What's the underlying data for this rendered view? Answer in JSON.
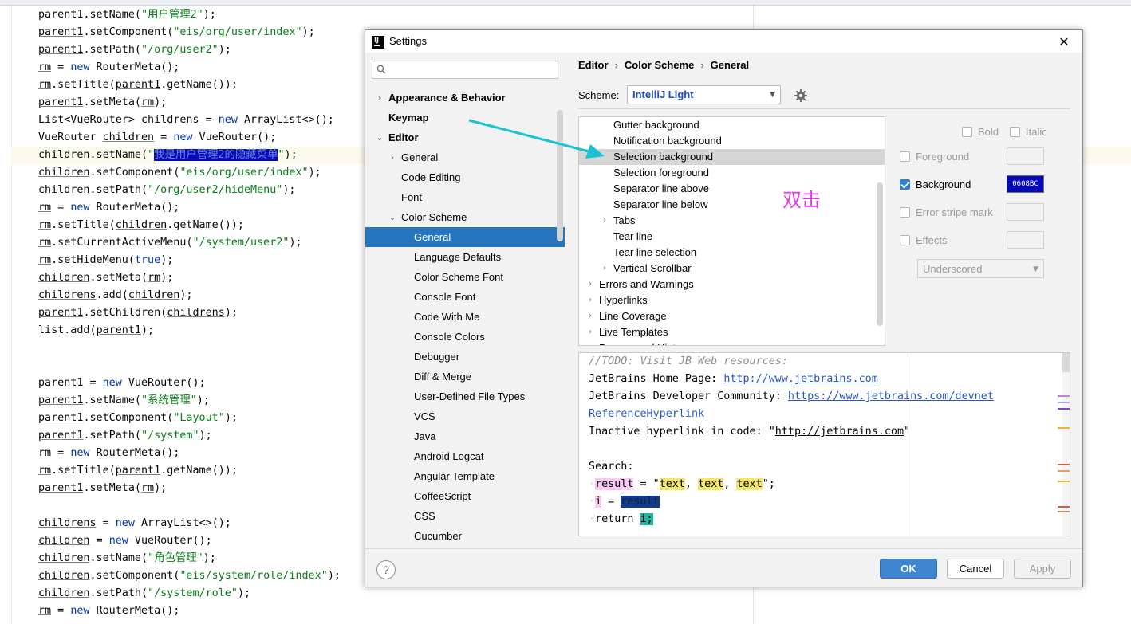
{
  "editor": {
    "lines": [
      {
        "segments": [
          {
            "t": "parent1.setName(",
            "c": ""
          },
          {
            "t": "\"用户管理2\"",
            "c": "str"
          },
          {
            "t": ");",
            "c": ""
          }
        ]
      },
      {
        "segments": [
          {
            "t": "parent1",
            "c": "u"
          },
          {
            "t": ".setComponent(",
            "c": ""
          },
          {
            "t": "\"eis/org/user/index\"",
            "c": "str"
          },
          {
            "t": ");",
            "c": ""
          }
        ]
      },
      {
        "segments": [
          {
            "t": "parent1",
            "c": "u"
          },
          {
            "t": ".setPath(",
            "c": ""
          },
          {
            "t": "\"/org/user2\"",
            "c": "str"
          },
          {
            "t": ");",
            "c": ""
          }
        ]
      },
      {
        "segments": [
          {
            "t": "rm",
            "c": "u"
          },
          {
            "t": " = ",
            "c": ""
          },
          {
            "t": "new",
            "c": "kw"
          },
          {
            "t": " RouterMeta();",
            "c": ""
          }
        ]
      },
      {
        "segments": [
          {
            "t": "rm",
            "c": "u"
          },
          {
            "t": ".setTitle(",
            "c": ""
          },
          {
            "t": "parent1",
            "c": "u"
          },
          {
            "t": ".getName());",
            "c": ""
          }
        ]
      },
      {
        "segments": [
          {
            "t": "parent1",
            "c": "u"
          },
          {
            "t": ".setMeta(",
            "c": ""
          },
          {
            "t": "rm",
            "c": "u"
          },
          {
            "t": ");",
            "c": ""
          }
        ]
      },
      {
        "segments": [
          {
            "t": "List<VueRouter> ",
            "c": ""
          },
          {
            "t": "childrens",
            "c": "u"
          },
          {
            "t": " = ",
            "c": ""
          },
          {
            "t": "new",
            "c": "kw"
          },
          {
            "t": " ArrayList<>();",
            "c": ""
          }
        ]
      },
      {
        "segments": [
          {
            "t": "VueRouter ",
            "c": ""
          },
          {
            "t": "children",
            "c": "u"
          },
          {
            "t": " = ",
            "c": ""
          },
          {
            "t": "new",
            "c": "kw"
          },
          {
            "t": " VueRouter();",
            "c": ""
          }
        ]
      },
      {
        "highlight": true,
        "segments": [
          {
            "t": "children",
            "c": "u"
          },
          {
            "t": ".setName(",
            "c": ""
          },
          {
            "t": "\"",
            "c": "str"
          },
          {
            "t": "我是用户管理2的隐藏菜单",
            "c": "selstr"
          },
          {
            "t": "\"",
            "c": "str"
          },
          {
            "t": ");",
            "c": ""
          }
        ]
      },
      {
        "segments": [
          {
            "t": "children",
            "c": "u"
          },
          {
            "t": ".setComponent(",
            "c": ""
          },
          {
            "t": "\"eis/org/user/index\"",
            "c": "str"
          },
          {
            "t": ");",
            "c": ""
          }
        ]
      },
      {
        "segments": [
          {
            "t": "children",
            "c": "u"
          },
          {
            "t": ".setPath(",
            "c": ""
          },
          {
            "t": "\"/org/user2/hideMenu\"",
            "c": "str"
          },
          {
            "t": ");",
            "c": ""
          }
        ]
      },
      {
        "segments": [
          {
            "t": "rm",
            "c": "u"
          },
          {
            "t": " = ",
            "c": ""
          },
          {
            "t": "new",
            "c": "kw"
          },
          {
            "t": " RouterMeta();",
            "c": ""
          }
        ]
      },
      {
        "segments": [
          {
            "t": "rm",
            "c": "u"
          },
          {
            "t": ".setTitle(",
            "c": ""
          },
          {
            "t": "children",
            "c": "u"
          },
          {
            "t": ".getName());",
            "c": ""
          }
        ]
      },
      {
        "segments": [
          {
            "t": "rm",
            "c": "u"
          },
          {
            "t": ".setCurrentActiveMenu(",
            "c": ""
          },
          {
            "t": "\"/system/user2\"",
            "c": "str"
          },
          {
            "t": ");",
            "c": ""
          }
        ]
      },
      {
        "segments": [
          {
            "t": "rm",
            "c": "u"
          },
          {
            "t": ".setHideMenu(",
            "c": ""
          },
          {
            "t": "true",
            "c": "kw"
          },
          {
            "t": ");",
            "c": ""
          }
        ]
      },
      {
        "segments": [
          {
            "t": "children",
            "c": "u"
          },
          {
            "t": ".setMeta(",
            "c": ""
          },
          {
            "t": "rm",
            "c": "u"
          },
          {
            "t": ");",
            "c": ""
          }
        ]
      },
      {
        "segments": [
          {
            "t": "childrens",
            "c": "u"
          },
          {
            "t": ".add(",
            "c": ""
          },
          {
            "t": "children",
            "c": "u"
          },
          {
            "t": ");",
            "c": ""
          }
        ]
      },
      {
        "segments": [
          {
            "t": "parent1",
            "c": "u"
          },
          {
            "t": ".setChildren(",
            "c": ""
          },
          {
            "t": "childrens",
            "c": "u"
          },
          {
            "t": ");",
            "c": ""
          }
        ]
      },
      {
        "segments": [
          {
            "t": "list.add(",
            "c": ""
          },
          {
            "t": "parent1",
            "c": "u"
          },
          {
            "t": ");",
            "c": ""
          }
        ]
      },
      {
        "segments": []
      },
      {
        "segments": []
      },
      {
        "segments": [
          {
            "t": "parent1",
            "c": "u"
          },
          {
            "t": " = ",
            "c": ""
          },
          {
            "t": "new",
            "c": "kw"
          },
          {
            "t": " VueRouter();",
            "c": ""
          }
        ]
      },
      {
        "segments": [
          {
            "t": "parent1",
            "c": "u"
          },
          {
            "t": ".setName(",
            "c": ""
          },
          {
            "t": "\"系统管理\"",
            "c": "str"
          },
          {
            "t": ");",
            "c": ""
          }
        ]
      },
      {
        "segments": [
          {
            "t": "parent1",
            "c": "u"
          },
          {
            "t": ".setComponent(",
            "c": ""
          },
          {
            "t": "\"Layout\"",
            "c": "str"
          },
          {
            "t": ");",
            "c": ""
          }
        ]
      },
      {
        "segments": [
          {
            "t": "parent1",
            "c": "u"
          },
          {
            "t": ".setPath(",
            "c": ""
          },
          {
            "t": "\"/system\"",
            "c": "str"
          },
          {
            "t": ");",
            "c": ""
          }
        ]
      },
      {
        "segments": [
          {
            "t": "rm",
            "c": "u"
          },
          {
            "t": " = ",
            "c": ""
          },
          {
            "t": "new",
            "c": "kw"
          },
          {
            "t": " RouterMeta();",
            "c": ""
          }
        ]
      },
      {
        "segments": [
          {
            "t": "rm",
            "c": "u"
          },
          {
            "t": ".setTitle(",
            "c": ""
          },
          {
            "t": "parent1",
            "c": "u"
          },
          {
            "t": ".getName());",
            "c": ""
          }
        ]
      },
      {
        "segments": [
          {
            "t": "parent1",
            "c": "u"
          },
          {
            "t": ".setMeta(",
            "c": ""
          },
          {
            "t": "rm",
            "c": "u"
          },
          {
            "t": ");",
            "c": ""
          }
        ]
      },
      {
        "segments": []
      },
      {
        "segments": [
          {
            "t": "childrens",
            "c": "u"
          },
          {
            "t": " = ",
            "c": ""
          },
          {
            "t": "new",
            "c": "kw"
          },
          {
            "t": " ArrayList<>();",
            "c": ""
          }
        ]
      },
      {
        "segments": [
          {
            "t": "children",
            "c": "u"
          },
          {
            "t": " = ",
            "c": ""
          },
          {
            "t": "new",
            "c": "kw"
          },
          {
            "t": " VueRouter();",
            "c": ""
          }
        ]
      },
      {
        "segments": [
          {
            "t": "children",
            "c": "u"
          },
          {
            "t": ".setName(",
            "c": ""
          },
          {
            "t": "\"角色管理\"",
            "c": "str"
          },
          {
            "t": ");",
            "c": ""
          }
        ]
      },
      {
        "segments": [
          {
            "t": "children",
            "c": "u"
          },
          {
            "t": ".setComponent(",
            "c": ""
          },
          {
            "t": "\"eis/system/role/index\"",
            "c": "str"
          },
          {
            "t": ");",
            "c": ""
          }
        ]
      },
      {
        "segments": [
          {
            "t": "children",
            "c": "u"
          },
          {
            "t": ".setPath(",
            "c": ""
          },
          {
            "t": "\"/system/role\"",
            "c": "str"
          },
          {
            "t": ");",
            "c": ""
          }
        ]
      },
      {
        "segments": [
          {
            "t": "rm",
            "c": "u"
          },
          {
            "t": " = ",
            "c": ""
          },
          {
            "t": "new",
            "c": "kw"
          },
          {
            "t": " RouterMeta();",
            "c": ""
          }
        ]
      }
    ]
  },
  "dialog": {
    "title": "Settings",
    "close_icon": "close-icon",
    "search": {
      "placeholder": "",
      "value": ""
    },
    "sidebar": {
      "items": [
        {
          "label": "Appearance & Behavior",
          "level": 0,
          "arrow": "right",
          "bold": true
        },
        {
          "label": "Keymap",
          "level": 0,
          "arrow": "none",
          "bold": true
        },
        {
          "label": "Editor",
          "level": 0,
          "arrow": "down",
          "bold": true
        },
        {
          "label": "General",
          "level": 1,
          "arrow": "right"
        },
        {
          "label": "Code Editing",
          "level": 1,
          "arrow": "none"
        },
        {
          "label": "Font",
          "level": 1,
          "arrow": "none"
        },
        {
          "label": "Color Scheme",
          "level": 1,
          "arrow": "down"
        },
        {
          "label": "General",
          "level": 2,
          "arrow": "none",
          "selected": true
        },
        {
          "label": "Language Defaults",
          "level": 2,
          "arrow": "none"
        },
        {
          "label": "Color Scheme Font",
          "level": 2,
          "arrow": "none"
        },
        {
          "label": "Console Font",
          "level": 2,
          "arrow": "none"
        },
        {
          "label": "Code With Me",
          "level": 2,
          "arrow": "none"
        },
        {
          "label": "Console Colors",
          "level": 2,
          "arrow": "none"
        },
        {
          "label": "Debugger",
          "level": 2,
          "arrow": "none"
        },
        {
          "label": "Diff & Merge",
          "level": 2,
          "arrow": "none"
        },
        {
          "label": "User-Defined File Types",
          "level": 2,
          "arrow": "none"
        },
        {
          "label": "VCS",
          "level": 2,
          "arrow": "none"
        },
        {
          "label": "Java",
          "level": 2,
          "arrow": "none"
        },
        {
          "label": "Android Logcat",
          "level": 2,
          "arrow": "none"
        },
        {
          "label": "Angular Template",
          "level": 2,
          "arrow": "none"
        },
        {
          "label": "CoffeeScript",
          "level": 2,
          "arrow": "none"
        },
        {
          "label": "CSS",
          "level": 2,
          "arrow": "none"
        },
        {
          "label": "Cucumber",
          "level": 2,
          "arrow": "none"
        }
      ]
    },
    "breadcrumb": [
      "Editor",
      "Color Scheme",
      "General"
    ],
    "scheme": {
      "label": "Scheme:",
      "value": "IntelliJ Light",
      "settings_icon": "gear-icon"
    },
    "options": {
      "items": [
        {
          "label": "Gutter background",
          "level": 2,
          "arrow": "none"
        },
        {
          "label": "Notification background",
          "level": 2,
          "arrow": "none"
        },
        {
          "label": "Selection background",
          "level": 2,
          "arrow": "none",
          "selected": true
        },
        {
          "label": "Selection foreground",
          "level": 2,
          "arrow": "none"
        },
        {
          "label": "Separator line above",
          "level": 2,
          "arrow": "none"
        },
        {
          "label": "Separator line below",
          "level": 2,
          "arrow": "none"
        },
        {
          "label": "Tabs",
          "level": 2,
          "arrow": "right"
        },
        {
          "label": "Tear line",
          "level": 2,
          "arrow": "none"
        },
        {
          "label": "Tear line selection",
          "level": 2,
          "arrow": "none"
        },
        {
          "label": "Vertical Scrollbar",
          "level": 2,
          "arrow": "right"
        },
        {
          "label": "Errors and Warnings",
          "level": 1,
          "arrow": "right"
        },
        {
          "label": "Hyperlinks",
          "level": 1,
          "arrow": "right"
        },
        {
          "label": "Line Coverage",
          "level": 1,
          "arrow": "right"
        },
        {
          "label": "Live Templates",
          "level": 1,
          "arrow": "right"
        },
        {
          "label": "Popups and Hints",
          "level": 1,
          "arrow": "right"
        }
      ]
    },
    "properties": {
      "bold": {
        "label": "Bold",
        "checked": false
      },
      "italic": {
        "label": "Italic",
        "checked": false
      },
      "foreground": {
        "label": "Foreground",
        "checked": false
      },
      "background": {
        "label": "Background",
        "checked": true,
        "color": "0608BC",
        "color_hex": "#0608bc"
      },
      "error_stripe": {
        "label": "Error stripe mark",
        "checked": false
      },
      "effects": {
        "label": "Effects",
        "checked": false,
        "style": "Underscored"
      }
    },
    "preview": {
      "lines": [
        [
          {
            "t": "//TODO: Visit JB Web resources:",
            "c": "cm"
          }
        ],
        [
          {
            "t": "JetBrains Home Page: ",
            "c": ""
          },
          {
            "t": "http://www.jetbrains.com",
            "c": "lnk"
          }
        ],
        [
          {
            "t": "JetBrains Developer Community: ",
            "c": ""
          },
          {
            "t": "https://www.jetbrains.com/devnet",
            "c": "lnk"
          }
        ],
        [
          {
            "t": "ReferenceHyperlink",
            "c": "rh"
          }
        ],
        [
          {
            "t": "Inactive hyperlink in code: \"",
            "c": ""
          },
          {
            "t": "http://jetbrains.com",
            "c": "ul"
          },
          {
            "t": "\"",
            "c": ""
          }
        ],
        [],
        [
          {
            "t": "Search:",
            "c": ""
          }
        ],
        [
          {
            "t": "·",
            "c": "dot"
          },
          {
            "t": "result",
            "c": "pink"
          },
          {
            "t": " = \"",
            "c": ""
          },
          {
            "t": "text",
            "c": "yel"
          },
          {
            "t": ", ",
            "c": ""
          },
          {
            "t": "text",
            "c": "yel"
          },
          {
            "t": ", ",
            "c": ""
          },
          {
            "t": "text",
            "c": "yel"
          },
          {
            "t": "\";",
            "c": ""
          }
        ],
        [
          {
            "t": "·",
            "c": "dot"
          },
          {
            "t": "i",
            "c": "pink"
          },
          {
            "t": " = ",
            "c": ""
          },
          {
            "t": "result",
            "c": "dsel"
          }
        ],
        [
          {
            "t": "·",
            "c": "dot"
          },
          {
            "t": "return ",
            "c": ""
          },
          {
            "t": "i;",
            "c": "teal"
          }
        ]
      ]
    },
    "buttons": {
      "ok": "OK",
      "cancel": "Cancel",
      "apply": "Apply",
      "help": "?"
    }
  },
  "annotation": {
    "text": "双击",
    "color": "#e737e2",
    "arrow_color": "#19c3d4"
  }
}
